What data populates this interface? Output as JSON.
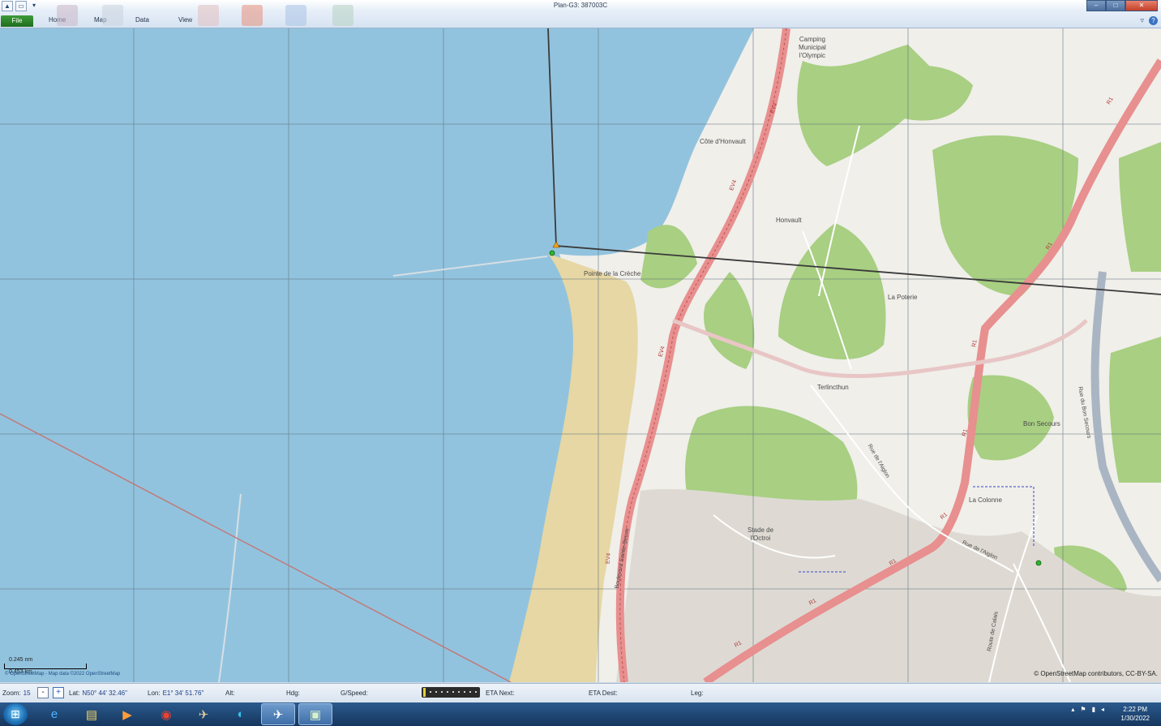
{
  "window": {
    "title": "Plan-G3: 387003C",
    "controls": [
      "minimize-icon",
      "maximize-icon",
      "close-icon"
    ]
  },
  "ribbon": {
    "file_label": "File",
    "tabs": [
      "Home",
      "Map",
      "Data",
      "View"
    ]
  },
  "map": {
    "labels": {
      "camping": "Camping\nMunicipal\nl'Olympic",
      "cote_honvault": "Côte d'Honvault",
      "honvault": "Honvault",
      "pointe": "Pointe de la Crèche",
      "la_poterie": "La Poterie",
      "terlincthun": "Terlincthun",
      "bon_secours": "Bon Secours",
      "la_colonne": "La Colonne",
      "stade": "Stade de\nl'Octroi",
      "rue_aiglon_1": "Rue de l'Aiglon",
      "rue_aiglon_2": "Rue de l'Aiglon",
      "boulevard": "Boulevard Sainte-Beuve",
      "route_calais": "Route de Calais",
      "rue_bon_secours": "Rue du Bon Secours",
      "ev4": "EV4",
      "r1": "R1"
    },
    "scale": {
      "nm": "0.245 nm",
      "km": "0.453 km"
    },
    "attribution_left": "© OpenStreetMap - Map data ©2022 OpenStreetMap",
    "attribution_right": "© OpenStreetMap contributors, CC-BY-SA."
  },
  "status": {
    "zoom_label": "Zoom:",
    "zoom_value": "15",
    "zoom_minus": "-",
    "zoom_plus": "+",
    "lat_label": "Lat:",
    "lat_value": "N50° 44' 32.46\"",
    "lon_label": "Lon:",
    "lon_value": "E1° 34' 51.76\"",
    "alt_label": "Alt:",
    "hdg_label": "Hdg:",
    "gspeed_label": "G/Speed:",
    "eta_next_label": "ETA Next:",
    "eta_dest_label": "ETA Dest:",
    "leg_label": "Leg:",
    "speed_slider_level": 0.0
  },
  "taskbar": {
    "apps": [
      "internet-explorer-icon",
      "file-explorer-icon",
      "media-player-icon",
      "chrome-icon",
      "flight-sim-icon",
      "edge-icon",
      "plan-g-icon",
      "remote-desktop-icon"
    ],
    "clock_time": "2:22 PM",
    "clock_date": "1/30/2022"
  },
  "colors": {
    "sea": "#92c3de",
    "land": "#f0efea",
    "forest": "#a8cf82",
    "sand": "#e6d7a4",
    "main_road": "#e88f8f",
    "route_line": "#3a3a3a",
    "accent_green": "#2b8c2b"
  }
}
